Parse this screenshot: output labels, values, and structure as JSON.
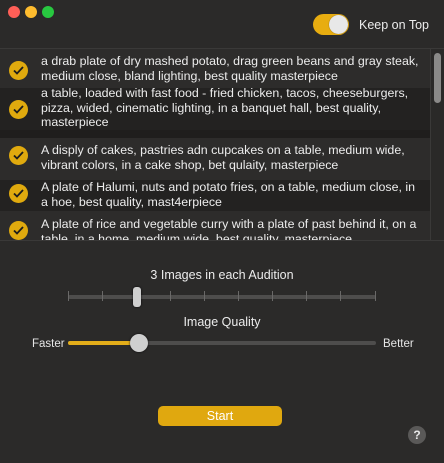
{
  "window": {
    "traffic_lights": [
      "close",
      "minimize",
      "zoom"
    ]
  },
  "header": {
    "keep_on_top_label": "Keep on Top",
    "keep_on_top_enabled": true
  },
  "prompts": [
    {
      "checked": true,
      "text": "a drab plate of dry mashed potato, drag green beans and gray steak, medium close, bland lighting, best quality masterpiece"
    },
    {
      "checked": true,
      "text": "a table, loaded with fast food - fried chicken, tacos, cheeseburgers, pizza,  wided, cinematic lighting, in a banquet hall, best quality, masterpiece"
    },
    {
      "checked": true,
      "text": "A disply of cakes, pastries adn cupcakes on a table, medium wide, vibrant colors, in a cake shop, bet qulaity, masterpiece"
    },
    {
      "checked": true,
      "text": "A plate of Halumi, nuts and potato fries, on  a table, medium close, in a hoe, best quality, mast4erpiece"
    },
    {
      "checked": true,
      "text": "A plate of rice and vegetable curry with a plate of past behind it, on a table, in a home, medium wide, best quality, masterpiece"
    }
  ],
  "audition": {
    "label": "3 Images in each Audition",
    "value": 3
  },
  "quality": {
    "label": "Image Quality",
    "min_label": "Faster",
    "max_label": "Better",
    "value_fraction": 0.23
  },
  "actions": {
    "start_label": "Start",
    "help_label": "?"
  },
  "colors": {
    "accent": "#e0a80f",
    "background": "#2b2a29",
    "list_background": "#1f1e1d"
  }
}
